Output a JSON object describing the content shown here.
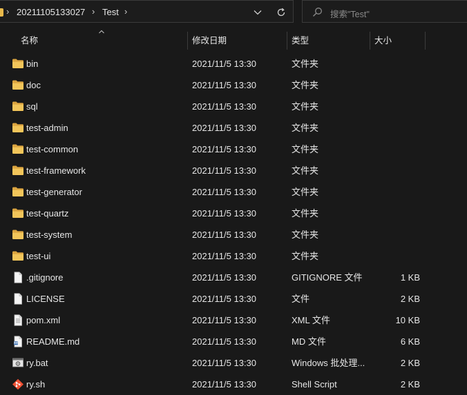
{
  "address_bar": {
    "breadcrumbs": [
      "20211105133027",
      "Test"
    ],
    "dropdown_icon": "chevron-down-icon",
    "refresh_icon": "refresh-icon"
  },
  "search": {
    "placeholder": "搜索\"Test\"",
    "icon": "search-icon"
  },
  "columns": {
    "name": "名称",
    "date": "修改日期",
    "type": "类型",
    "size": "大小"
  },
  "files": [
    {
      "name": "bin",
      "date": "2021/11/5 13:30",
      "type": "文件夹",
      "size": "",
      "icon": "folder-icon"
    },
    {
      "name": "doc",
      "date": "2021/11/5 13:30",
      "type": "文件夹",
      "size": "",
      "icon": "folder-icon"
    },
    {
      "name": "sql",
      "date": "2021/11/5 13:30",
      "type": "文件夹",
      "size": "",
      "icon": "folder-icon"
    },
    {
      "name": "test-admin",
      "date": "2021/11/5 13:30",
      "type": "文件夹",
      "size": "",
      "icon": "folder-icon"
    },
    {
      "name": "test-common",
      "date": "2021/11/5 13:30",
      "type": "文件夹",
      "size": "",
      "icon": "folder-icon"
    },
    {
      "name": "test-framework",
      "date": "2021/11/5 13:30",
      "type": "文件夹",
      "size": "",
      "icon": "folder-icon"
    },
    {
      "name": "test-generator",
      "date": "2021/11/5 13:30",
      "type": "文件夹",
      "size": "",
      "icon": "folder-icon"
    },
    {
      "name": "test-quartz",
      "date": "2021/11/5 13:30",
      "type": "文件夹",
      "size": "",
      "icon": "folder-icon"
    },
    {
      "name": "test-system",
      "date": "2021/11/5 13:30",
      "type": "文件夹",
      "size": "",
      "icon": "folder-icon"
    },
    {
      "name": "test-ui",
      "date": "2021/11/5 13:30",
      "type": "文件夹",
      "size": "",
      "icon": "folder-icon"
    },
    {
      "name": ".gitignore",
      "date": "2021/11/5 13:30",
      "type": "GITIGNORE 文件",
      "size": "1 KB",
      "icon": "file-icon"
    },
    {
      "name": "LICENSE",
      "date": "2021/11/5 13:30",
      "type": "文件",
      "size": "2 KB",
      "icon": "file-icon"
    },
    {
      "name": "pom.xml",
      "date": "2021/11/5 13:30",
      "type": "XML 文件",
      "size": "10 KB",
      "icon": "text-file-icon"
    },
    {
      "name": "README.md",
      "date": "2021/11/5 13:30",
      "type": "MD 文件",
      "size": "6 KB",
      "icon": "markdown-file-icon"
    },
    {
      "name": "ry.bat",
      "date": "2021/11/5 13:30",
      "type": "Windows 批处理...",
      "size": "2 KB",
      "icon": "batch-file-icon"
    },
    {
      "name": "ry.sh",
      "date": "2021/11/5 13:30",
      "type": "Shell Script",
      "size": "2 KB",
      "icon": "shell-script-icon"
    }
  ],
  "colors": {
    "background": "#191919",
    "folder": "#e8b84a",
    "text": "#e6e6e6"
  }
}
